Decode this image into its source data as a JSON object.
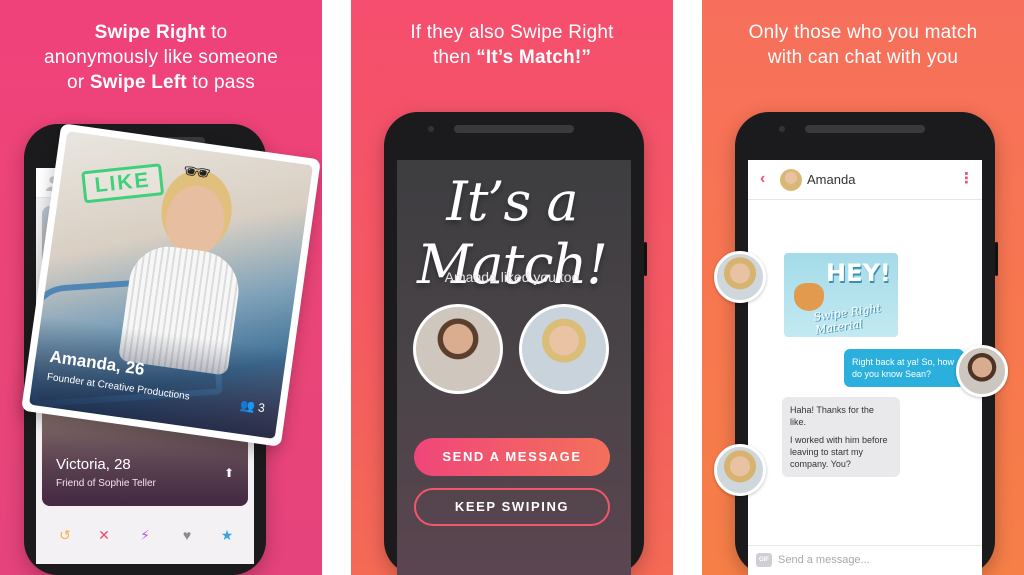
{
  "panel1": {
    "caption": {
      "line1_bold": "Swipe Right",
      "line1_rest": " to",
      "line2": "anonymously like someone",
      "line3_pre": "or ",
      "line3_bold": "Swipe Left",
      "line3_rest": " to pass"
    },
    "front_card": {
      "stamp": "LIKE",
      "name": "Amanda, 26",
      "subtitle": "Founder at Creative Productions",
      "friends_count": "3"
    },
    "back_card": {
      "name": "Victoria, 28",
      "subtitle": "Friend of Sophie Teller"
    },
    "actions": [
      "rewind",
      "nope",
      "boost",
      "like",
      "super-like"
    ]
  },
  "panel2": {
    "caption": {
      "line1": "If they also Swipe Right",
      "line2_pre": "then ",
      "line2_bold": "“It’s Match!”"
    },
    "match_title": "It’s a Match!",
    "liked_text": "Amanda liked you too",
    "send_button": "SEND A MESSAGE",
    "keep_button": "KEEP SWIPING"
  },
  "panel3": {
    "caption": {
      "line1": "Only those who you match",
      "line2": "with can chat with you"
    },
    "chat_name": "Amanda",
    "gif": {
      "headline": "HEY!",
      "subtitle": "Swipe Right Material"
    },
    "messages": [
      {
        "from": "me",
        "text": "Right back at ya! So, how do you know Sean?"
      },
      {
        "from": "amanda",
        "text": "Haha! Thanks for the like."
      },
      {
        "from": "amanda",
        "text": "I worked with him before leaving to start my company. You?"
      }
    ],
    "gif_button": "GIF",
    "input_placeholder": "Send a message..."
  },
  "colors": {
    "brand_pink": "#f0467a",
    "brand_orange": "#f3705a",
    "outgoing_bubble": "#2bb0dd",
    "like_stamp": "#3fd07a"
  }
}
